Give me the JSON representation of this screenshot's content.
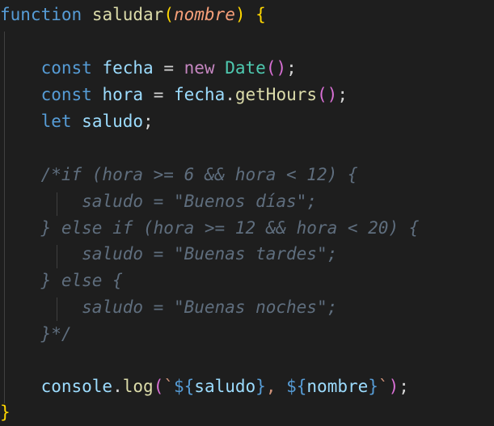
{
  "editor": {
    "theme": "dark",
    "background": "#1e1e1e",
    "lines": [
      {
        "text": "function saludar(nombre) {"
      },
      {
        "text": ""
      },
      {
        "text": "    const fecha = new Date();"
      },
      {
        "text": "    const hora = fecha.getHours();"
      },
      {
        "text": "    let saludo;"
      },
      {
        "text": ""
      },
      {
        "text": "    /*if (hora >= 6 && hora < 12) {"
      },
      {
        "text": "        saludo = \"Buenos días\";"
      },
      {
        "text": "    } else if (hora >= 12 && hora < 20) {"
      },
      {
        "text": "        saludo = \"Buenas tardes\";"
      },
      {
        "text": "    } else {"
      },
      {
        "text": "        saludo = \"Buenas noches\";"
      },
      {
        "text": "    }*/"
      },
      {
        "text": ""
      },
      {
        "text": "    console.log(`${saludo}, ${nombre}`);"
      },
      {
        "text": "}"
      }
    ],
    "tokens": {
      "l0_kw": "function",
      "l0_fn": "saludar",
      "l0_open": "(",
      "l0_param": "nombre",
      "l0_close": ")",
      "l0_brace": "{",
      "l2_kw": "const",
      "l2_var": "fecha",
      "l2_eq": "=",
      "l2_new": "new",
      "l2_cls": "Date",
      "l2_paren": "()",
      "l2_semi": ";",
      "l3_kw": "const",
      "l3_var": "hora",
      "l3_eq": "=",
      "l3_obj": "fecha",
      "l3_dot": ".",
      "l3_fn": "getHours",
      "l3_paren": "()",
      "l3_semi": ";",
      "l4_kw": "let",
      "l4_var": "saludo",
      "l4_semi": ";",
      "l6_comment": "/*if (hora >= 6 && hora < 12) {",
      "l7_comment": "saludo = \"Buenos días\";",
      "l8_comment": "} else if (hora >= 12 && hora < 20) {",
      "l9_comment": "saludo = \"Buenas tardes\";",
      "l10_comment": "} else {",
      "l11_comment": "saludo = \"Buenas noches\";",
      "l12_comment": "}*/",
      "l14_obj": "console",
      "l14_dot": ".",
      "l14_fn": "log",
      "l14_open": "(",
      "l14_tick1": "`",
      "l14_tpl1": "${",
      "l14_v1": "saludo",
      "l14_tpl1c": "}",
      "l14_sep": ", ",
      "l14_tpl2": "${",
      "l14_v2": "nombre",
      "l14_tpl2c": "}",
      "l14_tick2": "`",
      "l14_close": ")",
      "l14_semi": ";",
      "l15_brace": "}"
    }
  }
}
